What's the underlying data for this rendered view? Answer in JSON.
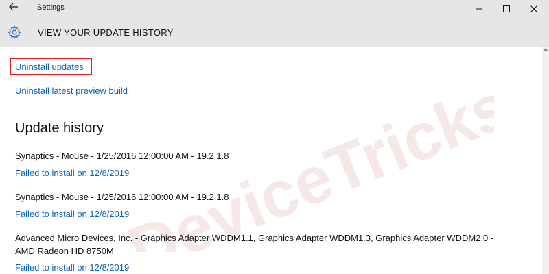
{
  "window": {
    "title": "Settings",
    "back_icon": "back-arrow-icon",
    "minimize_icon": "minimize-icon",
    "maximize_icon": "maximize-icon",
    "close_icon": "close-icon"
  },
  "header": {
    "icon": "gear-icon",
    "title": "VIEW YOUR UPDATE HISTORY"
  },
  "links": {
    "uninstall_updates": "Uninstall updates",
    "uninstall_preview": "Uninstall latest preview build"
  },
  "history": {
    "title": "Update history",
    "entries": [
      {
        "name": "Synaptics - Mouse - 1/25/2016 12:00:00 AM - 19.2.1.8",
        "status": "Failed to install on 12/8/2019"
      },
      {
        "name": "Synaptics - Mouse - 1/25/2016 12:00:00 AM - 19.2.1.8",
        "status": "Failed to install on 12/8/2019"
      },
      {
        "name_line1": "Advanced Micro Devices, Inc. - Graphics Adapter WDDM1.1, Graphics Adapter WDDM1.3, Graphics Adapter WDDM2.0 -",
        "name_line2": "AMD Radeon HD 8750M",
        "status": "Failed to install on 12/8/2019"
      }
    ]
  },
  "watermark": "DeviceTricks",
  "colors": {
    "link": "#0a63b8",
    "highlight": "#e01b1b",
    "titlebar": "#e6e6e6",
    "watermark": "#f1d9d9"
  }
}
